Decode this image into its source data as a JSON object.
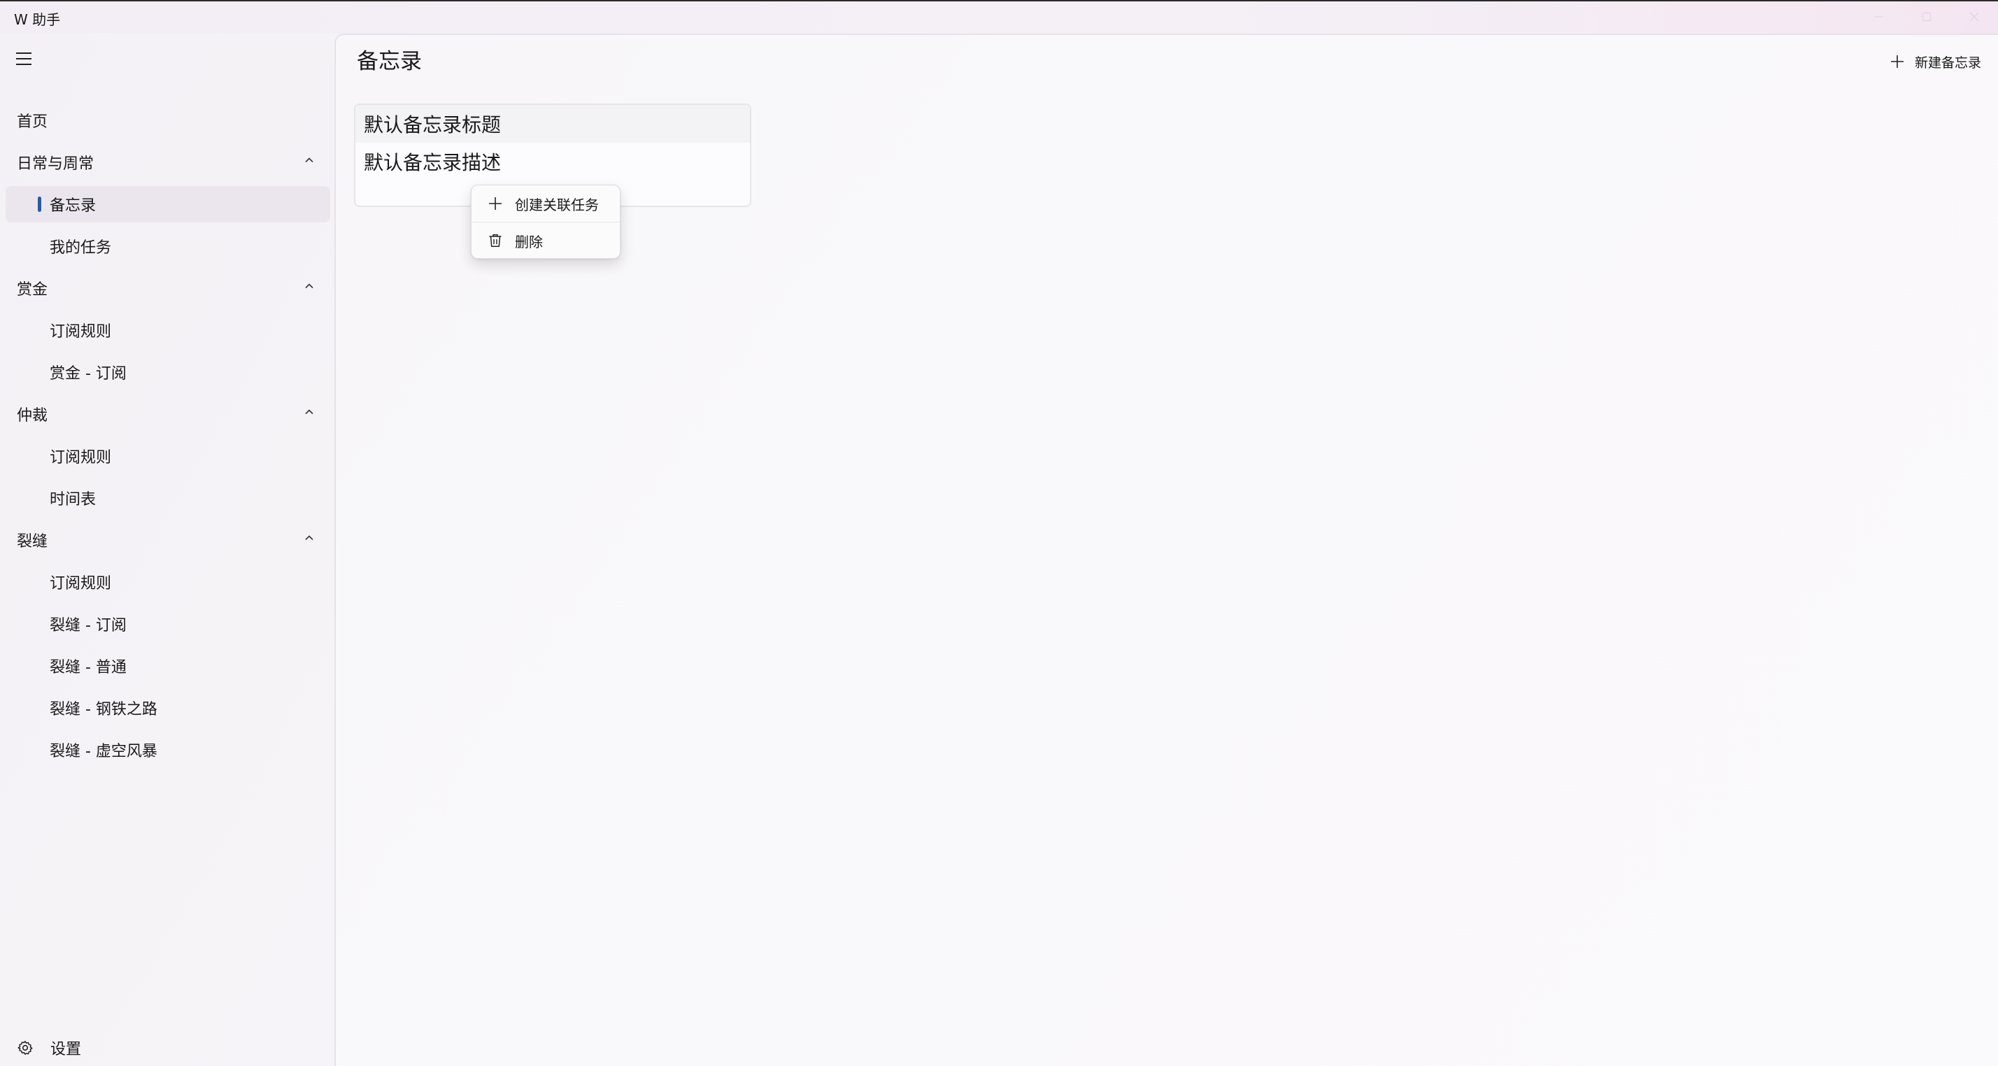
{
  "window": {
    "title": "W 助手",
    "controls": [
      "minimize",
      "maximize",
      "close"
    ]
  },
  "sidebar": {
    "menu_icon": "hamburger-icon",
    "items": [
      {
        "label": "首页",
        "level": "top"
      },
      {
        "label": "日常与周常",
        "level": "group",
        "expanded": true
      },
      {
        "label": "备忘录",
        "level": "sub",
        "selected": true
      },
      {
        "label": "我的任务",
        "level": "sub"
      },
      {
        "label": "赏金",
        "level": "group",
        "expanded": true
      },
      {
        "label": "订阅规则",
        "level": "sub"
      },
      {
        "label": "赏金 - 订阅",
        "level": "sub"
      },
      {
        "label": "仲裁",
        "level": "group",
        "expanded": true
      },
      {
        "label": "订阅规则",
        "level": "sub"
      },
      {
        "label": "时间表",
        "level": "sub"
      },
      {
        "label": "裂缝",
        "level": "group",
        "expanded": true
      },
      {
        "label": "订阅规则",
        "level": "sub"
      },
      {
        "label": "裂缝 - 订阅",
        "level": "sub"
      },
      {
        "label": "裂缝 - 普通",
        "level": "sub"
      },
      {
        "label": "裂缝 - 钢铁之路",
        "level": "sub"
      },
      {
        "label": "裂缝 - 虚空风暴",
        "level": "sub"
      }
    ],
    "settings_label": "设置",
    "selection_color": "#1f5ea8"
  },
  "main": {
    "page_title": "备忘录",
    "new_button_label": "新建备忘录",
    "memo": {
      "title": "默认备忘录标题",
      "description": "默认备忘录描述"
    },
    "context_menu": {
      "items": [
        {
          "label": "创建关联任务",
          "icon": "plus-icon"
        },
        {
          "label": "删除",
          "icon": "trash-icon"
        }
      ]
    }
  }
}
